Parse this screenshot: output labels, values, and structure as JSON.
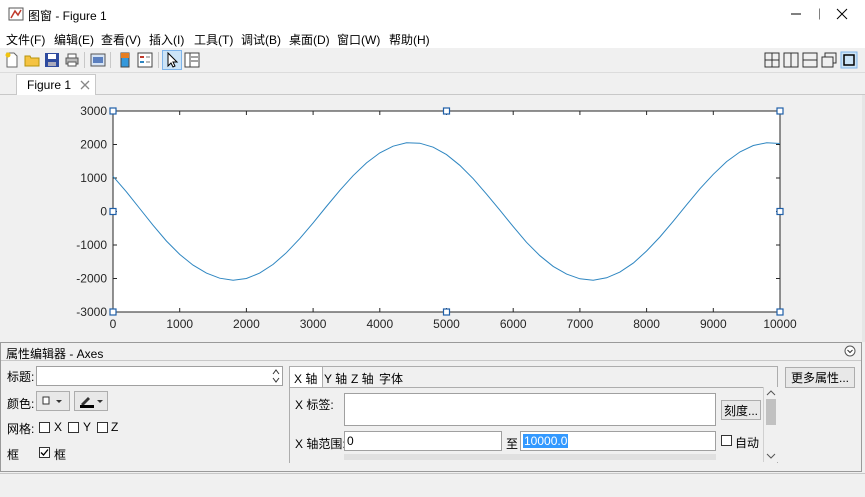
{
  "window": {
    "title": "图窗 - Figure 1"
  },
  "menu": [
    "文件(F)",
    "编辑(E)",
    "查看(V)",
    "插入(I)",
    "工具(T)",
    "调试(B)",
    "桌面(D)",
    "窗口(W)",
    "帮助(H)"
  ],
  "tab": {
    "label": "Figure 1"
  },
  "chart_data": {
    "type": "line",
    "title": "",
    "xlabel": "",
    "ylabel": "",
    "xlim": [
      0,
      10000
    ],
    "ylim": [
      -3000,
      3000
    ],
    "xticks": [
      "0",
      "1000",
      "2000",
      "3000",
      "4000",
      "5000",
      "6000",
      "7000",
      "8000",
      "9000",
      "10000"
    ],
    "yticks": [
      "3000",
      "2000",
      "1000",
      "0",
      "-1000",
      "-2000",
      "-3000"
    ],
    "series": [
      {
        "color": "#2e86c1",
        "x": [
          0,
          200,
          400,
          600,
          800,
          1000,
          1200,
          1400,
          1600,
          1800,
          2000,
          2200,
          2400,
          2600,
          2800,
          3000,
          3200,
          3400,
          3600,
          3800,
          4000,
          4200,
          4400,
          4600,
          4800,
          5000,
          5200,
          5400,
          5600,
          5800,
          6000,
          6200,
          6400,
          6600,
          6800,
          7000,
          7200,
          7400,
          7600,
          7800,
          8000,
          8200,
          8400,
          8600,
          8800,
          9000,
          9200,
          9400,
          9600,
          9800,
          10000
        ],
        "y": [
          1050,
          590,
          90,
          -410,
          -880,
          -1280,
          -1600,
          -1840,
          -1990,
          -2050,
          -2000,
          -1840,
          -1580,
          -1230,
          -810,
          -340,
          150,
          630,
          1070,
          1450,
          1750,
          1950,
          2050,
          2040,
          1920,
          1700,
          1380,
          980,
          520,
          40,
          -450,
          -920,
          -1320,
          -1640,
          -1870,
          -2010,
          -2050,
          -1980,
          -1810,
          -1540,
          -1180,
          -760,
          -290,
          200,
          680,
          1110,
          1490,
          1780,
          1970,
          2050,
          2030
        ]
      }
    ],
    "grid": false
  },
  "propeditor": {
    "header": "属性编辑器 - Axes",
    "title_label": "标题:",
    "color_label": "颜色:",
    "grid_label": "网格:",
    "grid_x": "X",
    "grid_y": "Y",
    "grid_z": "Z",
    "box_label": "框",
    "box_checkbox_label": "框",
    "tabs": [
      "X 轴",
      "Y 轴",
      "Z 轴",
      "字体"
    ],
    "x_label_label": "X 标签:",
    "ticks_button": "刻度...",
    "x_range_label": "X 轴范围:",
    "x_min": "0",
    "to_label": "至",
    "x_max": "10000.0",
    "auto_label": "自动",
    "more_props_button": "更多属性..."
  }
}
